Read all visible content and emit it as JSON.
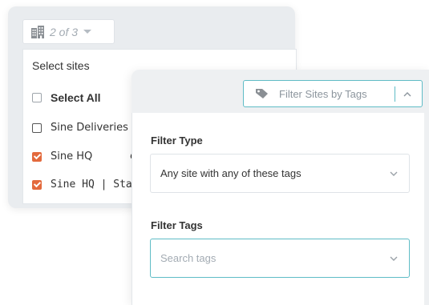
{
  "site_selector": {
    "count_text": "2 of 3",
    "icons": {
      "building": "building-icon",
      "caret": "caret-down-icon"
    },
    "menu_title": "Select sites",
    "items": [
      {
        "label": "Select All",
        "checked": false
      },
      {
        "label": "Sine Deliveries",
        "checked": false
      },
      {
        "label": "Sine HQ",
        "checked": true
      },
      {
        "label": "Sine HQ | Staff",
        "checked": true
      }
    ],
    "partial_text_e": "e"
  },
  "tag_filter": {
    "button_label": "Filter Sites by Tags",
    "icons": {
      "tag": "tag-icon",
      "toggle": "chevron-up-icon"
    },
    "filter_type": {
      "label": "Filter Type",
      "value": "Any site with any of these tags"
    },
    "filter_tags": {
      "label": "Filter Tags",
      "placeholder": "Search tags"
    }
  },
  "colors": {
    "accent": "#5fbcc6",
    "checkbox_checked": "#e36a3d",
    "muted_text": "#a3abb3"
  }
}
